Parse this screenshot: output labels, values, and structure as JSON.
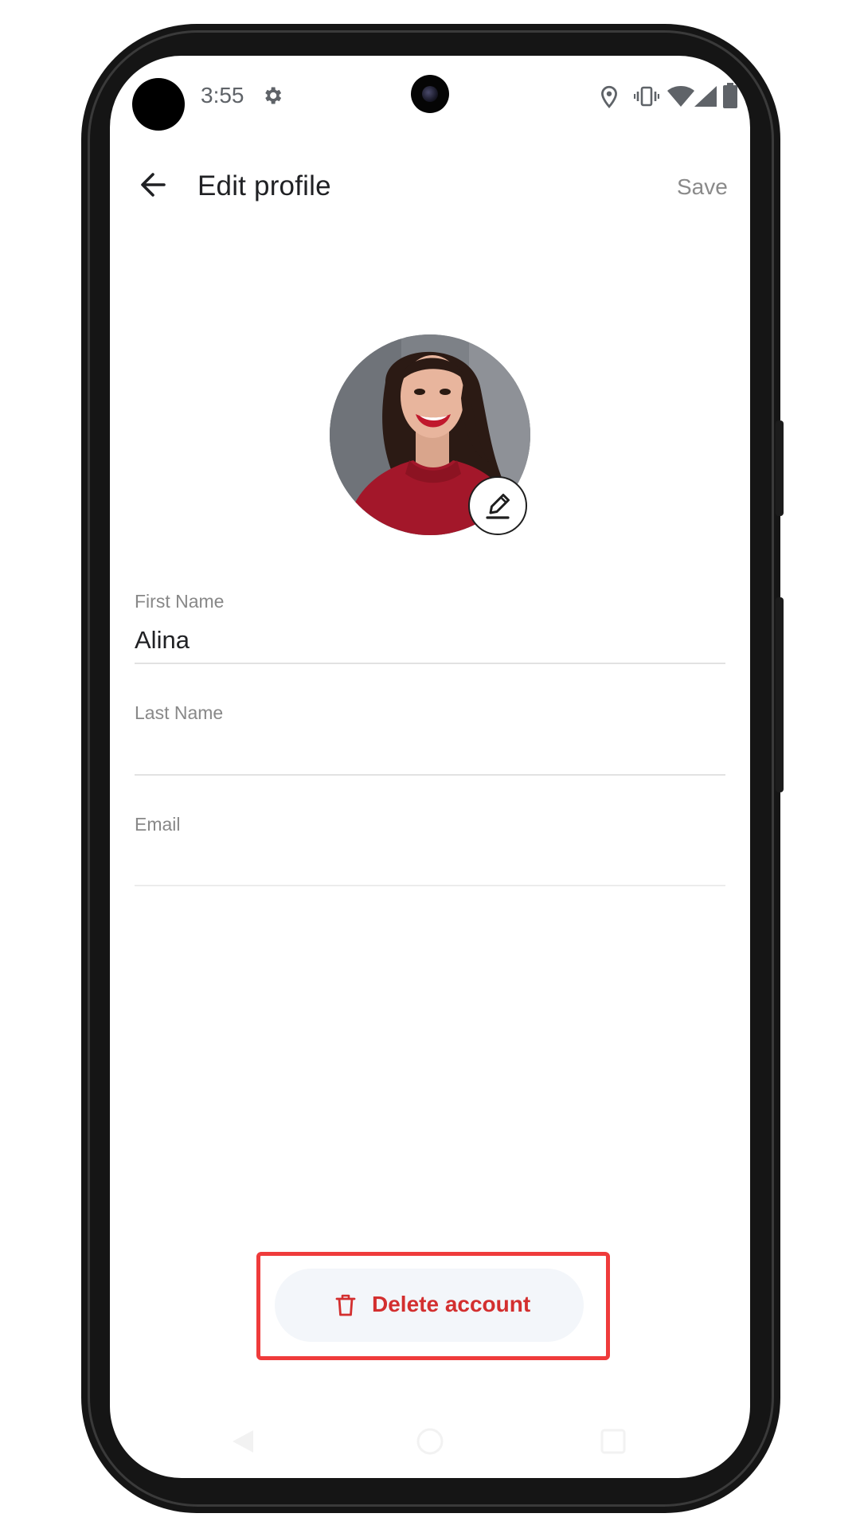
{
  "status_bar": {
    "time": "3:55",
    "icons": [
      "settings-gear-icon",
      "location-icon",
      "vibrate-icon",
      "wifi-icon",
      "signal-icon",
      "battery-icon"
    ]
  },
  "app_bar": {
    "back_icon": "arrow-left-icon",
    "title": "Edit profile",
    "save_label": "Save"
  },
  "profile": {
    "avatar_icon": "profile-photo",
    "edit_icon": "pencil-icon"
  },
  "form": {
    "first_name": {
      "label": "First Name",
      "value": "Alina"
    },
    "last_name": {
      "label": "Last Name",
      "value": ""
    },
    "email": {
      "label": "Email",
      "value": ""
    }
  },
  "actions": {
    "delete_label": "Delete account",
    "delete_icon": "trash-icon"
  },
  "colors": {
    "accent_danger": "#d32f2f",
    "highlight_border": "#ef3b3b",
    "pill_background": "#f3f6fa"
  }
}
